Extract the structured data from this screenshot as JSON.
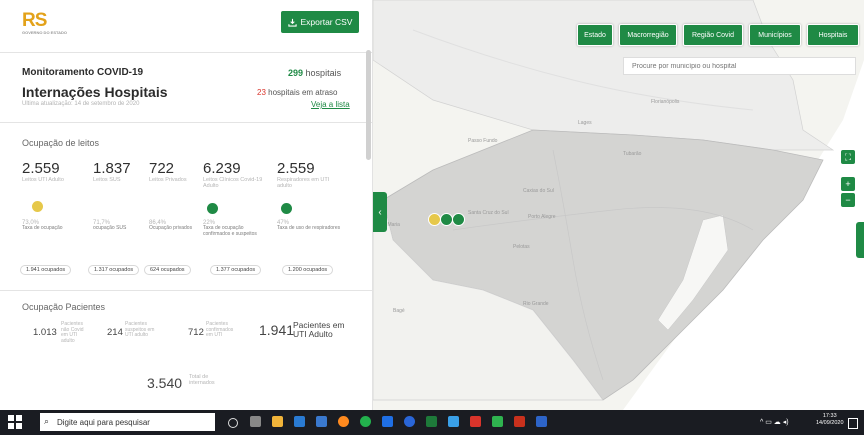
{
  "header": {
    "logo_text": "RS",
    "logo_sub": "GOVERNO DO ESTADO",
    "export_label": "Exportar CSV"
  },
  "summary": {
    "section_title": "Monitoramento COVID-19",
    "title": "Internações Hospitais",
    "updated": "Ultima atualização: 14 de setembro de 2020",
    "hospitals_count": "299",
    "hospitals_label": "hospitais",
    "late_count": "23",
    "late_label": "hospitais em atraso",
    "see_list": "Veja a lista"
  },
  "beds": {
    "section_title": "Ocupação de leitos",
    "items": [
      {
        "value": "2.559",
        "label": "Leitos UTI Adulto",
        "pct": "73,0%",
        "pct_label": "Taxa de ocupação",
        "occupied": "1.941 ocupados",
        "status": "yellow"
      },
      {
        "value": "1.837",
        "label": "Leitos SUS",
        "pct": "71,7%",
        "pct_label": "ocupação SUS",
        "occupied": "1.317 ocupados",
        "status": ""
      },
      {
        "value": "722",
        "label": "Leitos Privados",
        "pct": "86,4%",
        "pct_label": "Ocupação privados",
        "occupied": "624 ocupados",
        "status": ""
      },
      {
        "value": "6.239",
        "label": "Leitos Clínicos Covid-19 Adulto",
        "pct": "22%",
        "pct_label": "Taxa de ocupação confirmados e suspeitos",
        "occupied": "1.377 ocupados",
        "status": "green"
      },
      {
        "value": "2.559",
        "label": "Respiradores em UTI adulto",
        "pct": "47%",
        "pct_label": "Taxa de uso de respiradores",
        "occupied": "1.200 ocupados",
        "status": "green"
      }
    ]
  },
  "patients": {
    "section_title": "Ocupação Pacientes",
    "items": [
      {
        "value": "1.013",
        "label": "Pacientes não Covid em UTI adulto"
      },
      {
        "value": "214",
        "label": "Pacientes suspeitos em UTI adulto"
      },
      {
        "value": "712",
        "label": "Pacientes confirmados em UTI"
      }
    ],
    "uti_value": "1.941",
    "uti_label": "Pacientes em UTI Adulto",
    "total_value": "3.540",
    "total_label": "Total de internados"
  },
  "map": {
    "tabs": [
      "Estado",
      "Macrorregião",
      "Região Covid",
      "Municípios",
      "Hospitais"
    ],
    "active_tab": "Estado",
    "search_placeholder": "Procure por município ou hospital",
    "cities": [
      "Florianópolis",
      "Lages",
      "Tubarão",
      "Passo Fundo",
      "Caxias do Sul",
      "Porto Alegre",
      "Santa Cruz do Sul",
      "Santa Maria",
      "Pelotas",
      "Rio Grande",
      "Bagé"
    ],
    "status_dots": [
      "#e6c84a",
      "#1f8a45",
      "#1f8a45"
    ]
  },
  "taskbar": {
    "search_placeholder": "Digite aqui para pesquisar",
    "time": "17:33",
    "date": "14/09/2020"
  },
  "colors": {
    "accent": "#1f8a45",
    "warning": "#e6c84a",
    "late": "#d9342b"
  }
}
